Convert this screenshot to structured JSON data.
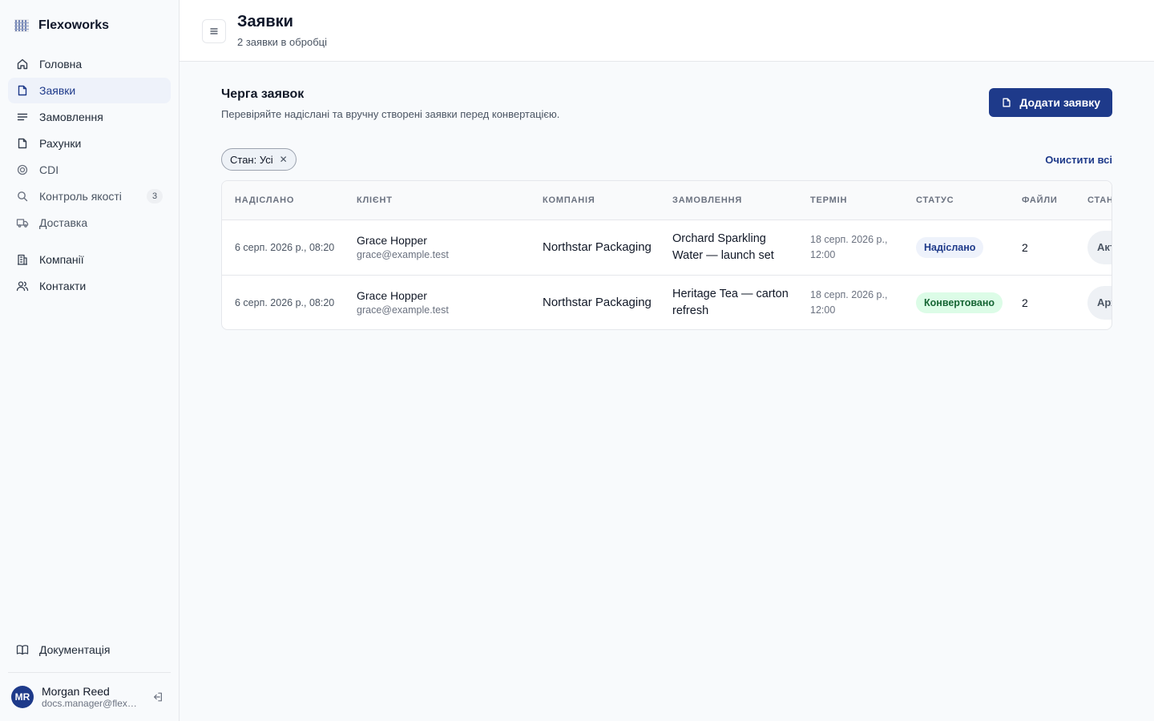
{
  "brand": {
    "name": "Flexoworks"
  },
  "sidebar": {
    "items": [
      {
        "label": "Головна",
        "icon": "home-icon",
        "active": false
      },
      {
        "label": "Заявки",
        "icon": "file-icon",
        "active": true
      },
      {
        "label": "Замовлення",
        "icon": "list-icon",
        "active": false
      },
      {
        "label": "Рахунки",
        "icon": "file-icon",
        "active": false
      },
      {
        "label": "CDI",
        "icon": "target-icon",
        "active": false
      },
      {
        "label": "Контроль якості",
        "icon": "search-icon",
        "active": false,
        "badge": "3"
      },
      {
        "label": "Доставка",
        "icon": "truck-icon",
        "active": false
      },
      {
        "label": "Компанії",
        "icon": "building-icon",
        "active": false
      },
      {
        "label": "Контакти",
        "icon": "users-icon",
        "active": false
      }
    ],
    "docs_label": "Документація",
    "user": {
      "initials": "MR",
      "name": "Morgan Reed",
      "email": "docs.manager@flexoworks.test"
    }
  },
  "header": {
    "title": "Заявки",
    "subtitle": "2 заявки в обробці"
  },
  "section": {
    "title": "Черга заявок",
    "description": "Перевіряйте надіслані та вручну створені заявки перед конвертацією.",
    "add_button": "Додати заявку"
  },
  "filters": {
    "chip": "Стан: Усі",
    "clear_all": "Очистити всі"
  },
  "table": {
    "columns": [
      "НАДІСЛАНО",
      "КЛІЄНТ",
      "КОМПАНІЯ",
      "ЗАМОВЛЕННЯ",
      "ТЕРМІН",
      "СТАТУС",
      "ФАЙЛИ",
      "СТАН"
    ],
    "rows": [
      {
        "submitted": "6 серп. 2026 р., 08:20",
        "client_name": "Grace Hopper",
        "client_email": "grace@example.test",
        "company": "Northstar Packaging",
        "order": "Orchard Sparkling Water — launch set",
        "deadline_date": "18 серп. 2026 р.,",
        "deadline_time": "12:00",
        "status": "Надіслано",
        "files": "2",
        "state": "Активна"
      },
      {
        "submitted": "6 серп. 2026 р., 08:20",
        "client_name": "Grace Hopper",
        "client_email": "grace@example.test",
        "company": "Northstar Packaging",
        "order": "Heritage Tea — carton refresh",
        "deadline_date": "18 серп. 2026 р.,",
        "deadline_time": "12:00",
        "status": "Конвертовано",
        "files": "2",
        "state": "Архівна"
      }
    ]
  },
  "colors": {
    "accent": "#1e3a8a",
    "converted_bg": "#dcfce7",
    "converted_fg": "#166534",
    "sent_bg": "#eef2fb"
  }
}
